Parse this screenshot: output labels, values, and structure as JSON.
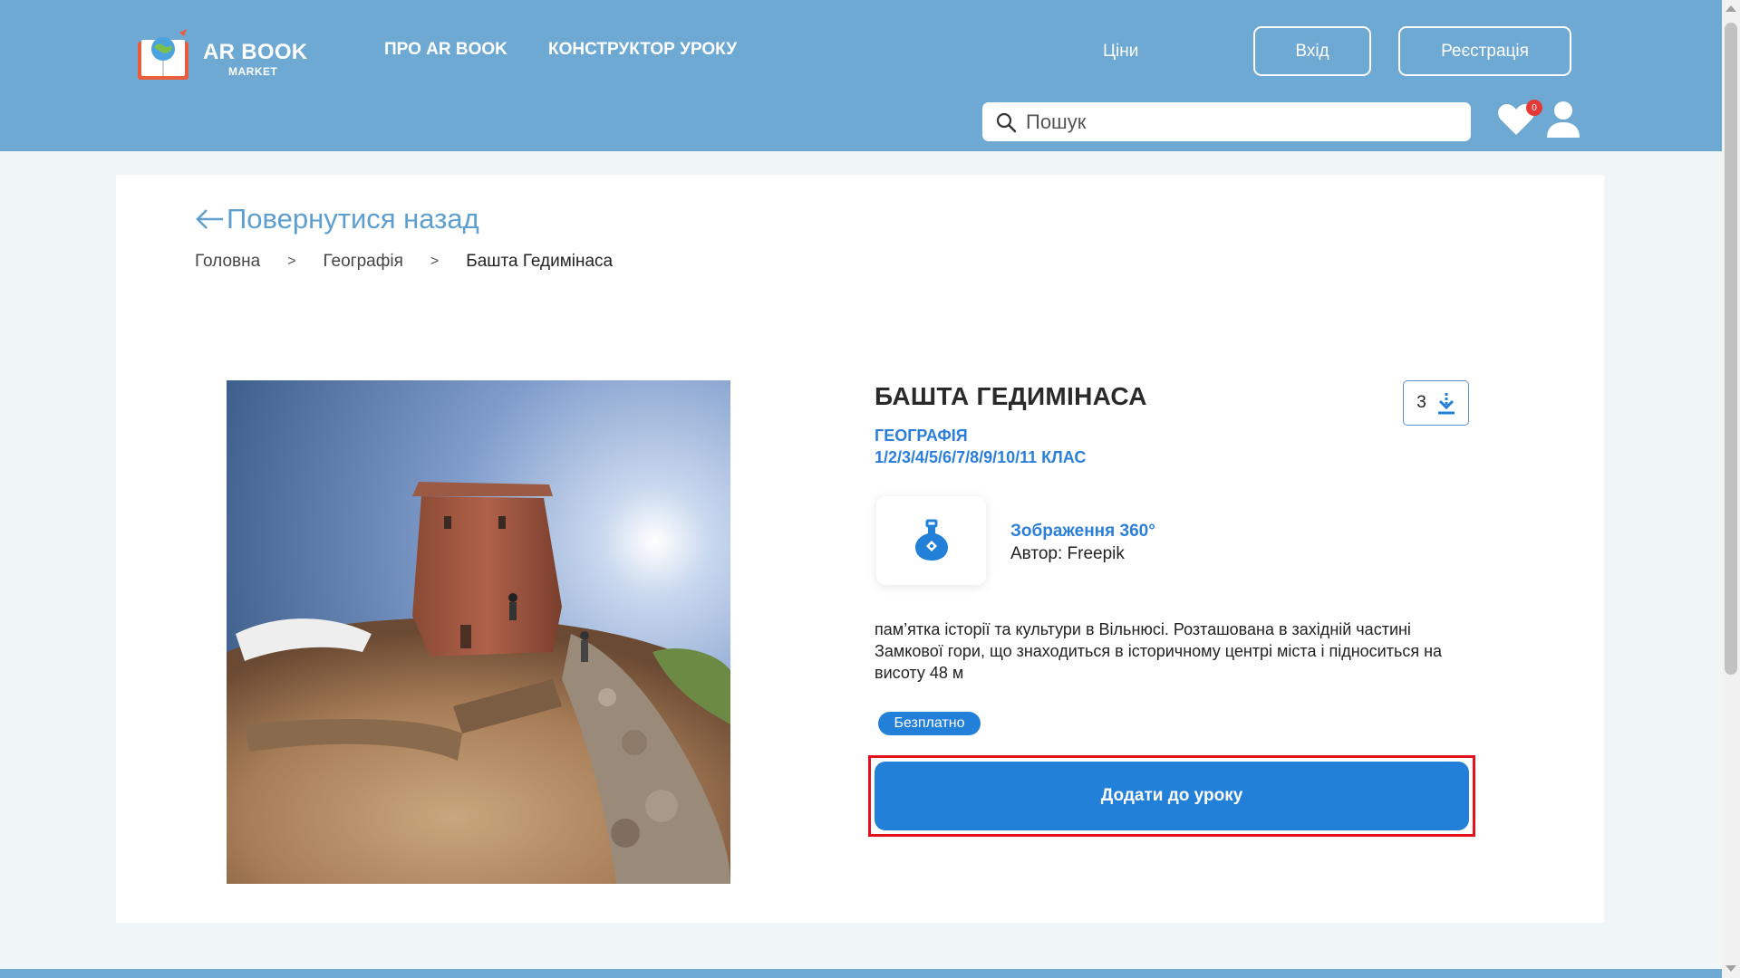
{
  "header": {
    "logo_title": "AR BOOK",
    "logo_sub": "MARKET",
    "nav": [
      {
        "label": "ПРО AR BOOK",
        "icon": ""
      },
      {
        "label": "КОНСТРУКТОР УРОКУ",
        "icon": ""
      }
    ],
    "prices_label": "Ціни",
    "login_label": "Вхід",
    "register_label": "Реєстрація",
    "search_placeholder": "Пошук",
    "favorites_count": "0",
    "icons": [
      "search-icon",
      "heart-icon",
      "user-icon",
      "logo-book-icon"
    ]
  },
  "back_label": "Повернутися назад",
  "breadcrumb": {
    "items": [
      "Головна",
      "Географія"
    ],
    "current": "Башта Гедимінаса",
    "separator": ">"
  },
  "product": {
    "title": "БАШТА ГЕДИМІНАСА",
    "subject": "ГЕОГРАФІЯ",
    "grades": "1/2/3/4/5/6/7/8/9/10/11 КЛАС",
    "downloads": "3",
    "type_name": "Зображення 360°",
    "author": "Автор: Freepik",
    "description": "пам’ятка історії та культури в Вільнюсі. Розташована в західній частині Замкової гори, що знаходиться в історичному центрі міста і підноситься на висоту 48 м",
    "price_badge": "Безплатно",
    "add_button": "Додати до уроку"
  },
  "colors": {
    "header_bg": "#6ea9d4",
    "accent": "#2280d9",
    "link": "#2b7fd9",
    "highlight": "#e3101d"
  }
}
